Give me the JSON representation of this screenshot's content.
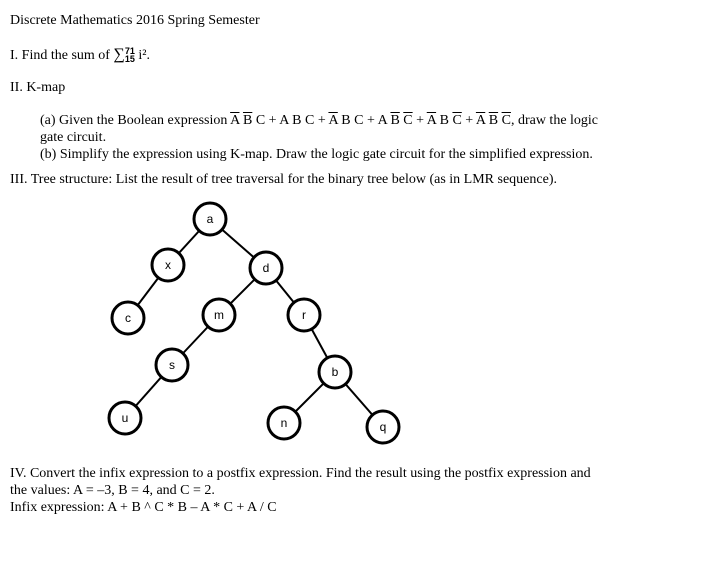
{
  "title": "Discrete Mathematics 2016 Spring Semester",
  "q1": {
    "prefix": "I.  Find the sum of ",
    "sigma": "∑",
    "upper": "71",
    "lower": "15",
    "term": "i²."
  },
  "q2": {
    "heading": "II. K-map",
    "a_prefix": "(a) Given the Boolean expression ",
    "a_terms": [
      {
        "vars": [
          {
            "v": "A",
            "bar": true
          },
          {
            "v": "B",
            "bar": true
          },
          {
            "v": "C",
            "bar": false
          }
        ]
      },
      {
        "vars": [
          {
            "v": "A",
            "bar": false
          },
          {
            "v": "B",
            "bar": false
          },
          {
            "v": "C",
            "bar": false
          }
        ]
      },
      {
        "vars": [
          {
            "v": "A",
            "bar": true
          },
          {
            "v": "B",
            "bar": false
          },
          {
            "v": "C",
            "bar": false
          }
        ]
      },
      {
        "vars": [
          {
            "v": "A",
            "bar": false
          },
          {
            "v": "B",
            "bar": true
          },
          {
            "v": "C",
            "bar": true
          }
        ]
      },
      {
        "vars": [
          {
            "v": "A",
            "bar": true
          },
          {
            "v": "B",
            "bar": false
          },
          {
            "v": "C",
            "bar": true
          }
        ]
      },
      {
        "vars": [
          {
            "v": "A",
            "bar": true
          },
          {
            "v": "B",
            "bar": true
          },
          {
            "v": "C",
            "bar": true
          }
        ]
      }
    ],
    "a_suffix": ", draw the logic",
    "a_line2": "gate circuit.",
    "b": "(b) Simplify  the expression using K-map.  Draw the logic  gate circuit  for the simplified  expression."
  },
  "q3": {
    "heading": "III. Tree structure: List the result of tree traversal for the binary tree below (as in LMR sequence).",
    "tree": {
      "nodes": [
        {
          "id": "a",
          "label": "a"
        },
        {
          "id": "x",
          "label": "x"
        },
        {
          "id": "d",
          "label": "d"
        },
        {
          "id": "c",
          "label": "c"
        },
        {
          "id": "m",
          "label": "m"
        },
        {
          "id": "r",
          "label": "r"
        },
        {
          "id": "s",
          "label": "s"
        },
        {
          "id": "b",
          "label": "b"
        },
        {
          "id": "u",
          "label": "u"
        },
        {
          "id": "n",
          "label": "n"
        },
        {
          "id": "q",
          "label": "q"
        }
      ],
      "edges": [
        [
          "a",
          "x"
        ],
        [
          "a",
          "d"
        ],
        [
          "x",
          "c"
        ],
        [
          "d",
          "m"
        ],
        [
          "d",
          "r"
        ],
        [
          "m",
          "s"
        ],
        [
          "s",
          "u"
        ],
        [
          "r",
          "b"
        ],
        [
          "b",
          "n"
        ],
        [
          "b",
          "q"
        ]
      ]
    }
  },
  "q4": {
    "line1": "IV. Convert the infix  expression to a postfix  expression.  Find  the result using  the postfix  expression and",
    "line2": "the values:  A = –3,  B = 4,  and C = 2.",
    "line3": "Infix expression:   A + B ^ C * B – A * C + A / C"
  }
}
